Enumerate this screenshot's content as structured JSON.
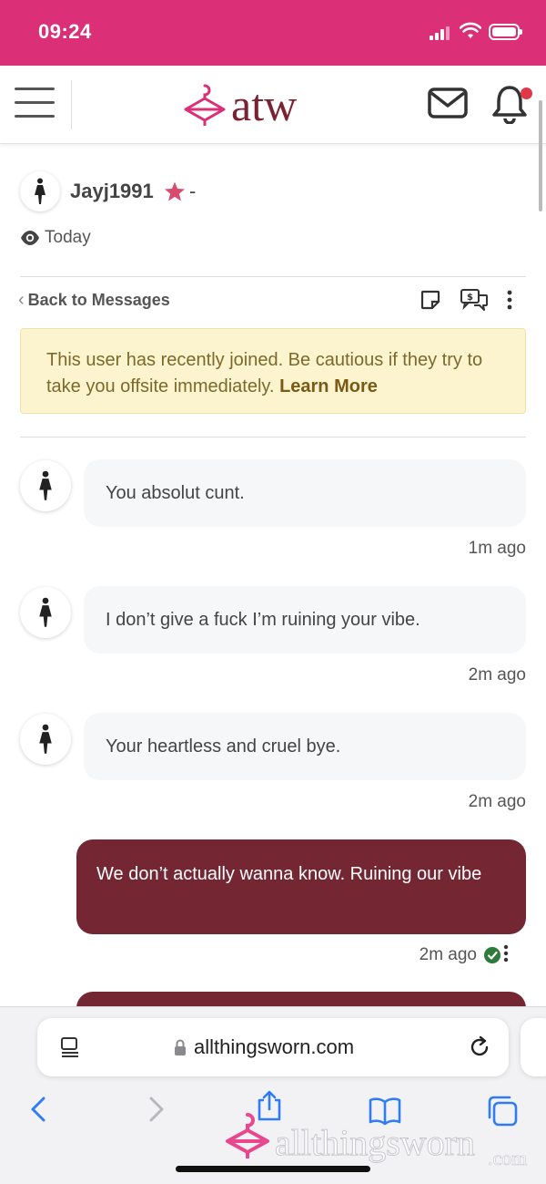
{
  "status_bar": {
    "time": "09:24"
  },
  "header": {
    "logo_text": "atw",
    "brand_color": "#7a2231",
    "accent_color": "#db2f78",
    "icons": [
      "menu-icon",
      "mail-icon",
      "bell-icon"
    ],
    "has_notification": true
  },
  "profile": {
    "username": "Jayj1991",
    "separator": "-",
    "last_seen": "Today"
  },
  "toolbar": {
    "back_label": "Back to Messages",
    "icons": [
      "note-icon",
      "conversation-icon",
      "more-icon"
    ]
  },
  "alert": {
    "text": "This user has recently joined. Be cautious if they try to take you offsite immediately.",
    "link": "Learn More",
    "background": "#fcf3cf"
  },
  "messages": [
    {
      "direction": "incoming",
      "text": "You absolut cunt.",
      "time": "1m ago"
    },
    {
      "direction": "incoming",
      "text": "I don’t give a fuck I’m ruining your vibe.",
      "time": "2m ago"
    },
    {
      "direction": "incoming",
      "text": "Your heartless and cruel bye.",
      "time": "2m ago"
    },
    {
      "direction": "outgoing",
      "text": "We don’t actually wanna know. Ruining our vibe",
      "time": "2m ago",
      "status": "read"
    }
  ],
  "outgoing_bubble_color": "#742633",
  "browser": {
    "url": "allthingsworn.com",
    "watermark_text": "allthingsworn",
    "watermark_suffix": ".com"
  }
}
